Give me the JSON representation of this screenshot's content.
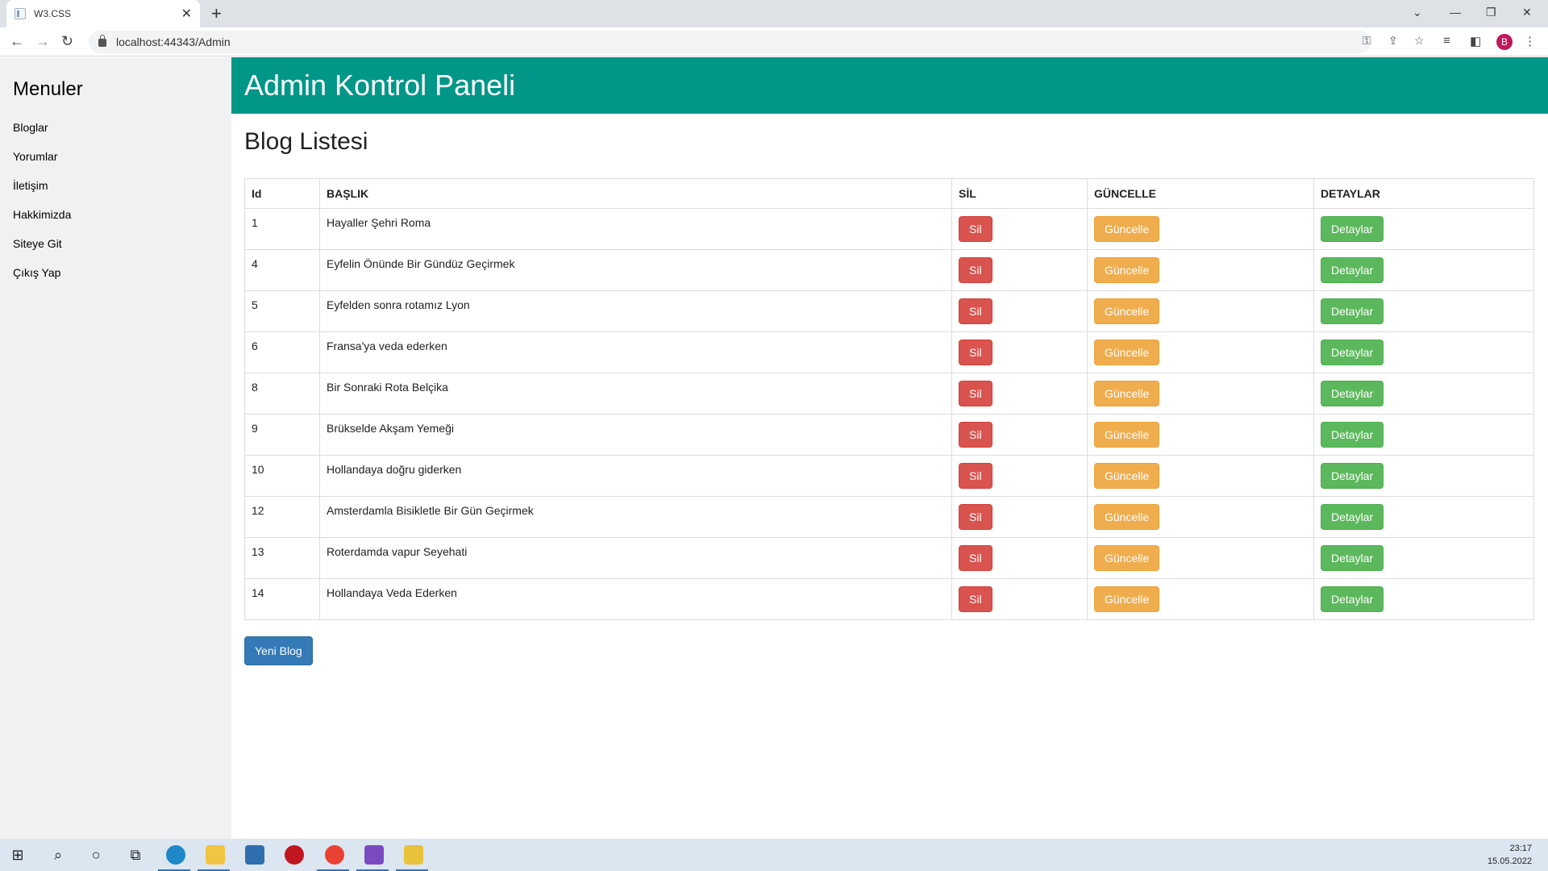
{
  "browser": {
    "tab_title": "W3.CSS",
    "tab_close": "✕",
    "new_tab": "+",
    "url": "localhost:44343/Admin",
    "avatar_letter": "B",
    "window_controls": {
      "dropdown": "⌄",
      "minimize": "—",
      "restore": "❐",
      "close": "✕"
    }
  },
  "sidebar": {
    "title": "Menuler",
    "items": [
      {
        "label": "Bloglar"
      },
      {
        "label": "Yorumlar"
      },
      {
        "label": "İletişim"
      },
      {
        "label": "Hakkimizda"
      },
      {
        "label": "Siteye Git"
      },
      {
        "label": "Çıkış Yap"
      }
    ]
  },
  "header": {
    "title": "Admin Kontrol Paneli"
  },
  "main": {
    "heading": "Blog Listesi",
    "columns": [
      "Id",
      "BAŞLIK",
      "SİL",
      "GÜNCELLE",
      "DETAYLAR"
    ],
    "delete_label": "Sil",
    "update_label": "Güncelle",
    "details_label": "Detaylar",
    "rows": [
      {
        "id": "1",
        "title": "Hayaller Şehri Roma"
      },
      {
        "id": "4",
        "title": "Eyfelin Önünde Bir Gündüz Geçirmek"
      },
      {
        "id": "5",
        "title": "Eyfelden sonra rotamız Lyon"
      },
      {
        "id": "6",
        "title": "Fransa'ya veda ederken"
      },
      {
        "id": "8",
        "title": "Bir Sonraki Rota Belçika"
      },
      {
        "id": "9",
        "title": "Brükselde Akşam Yemeği"
      },
      {
        "id": "10",
        "title": "Hollandaya doğru giderken"
      },
      {
        "id": "12",
        "title": "Amsterdamla Bisikletle Bir Gün Geçirmek"
      },
      {
        "id": "13",
        "title": "Roterdamda vapur Seyehati"
      },
      {
        "id": "14",
        "title": "Hollandaya Veda Ederken"
      }
    ],
    "new_button": "Yeni Blog"
  },
  "colors": {
    "header": "#009688",
    "danger": "#d9534f",
    "warning": "#f0ad4e",
    "success": "#5cb85c",
    "primary": "#337ab7"
  },
  "taskbar": {
    "time": "23:17",
    "date": "15.05.2022"
  }
}
